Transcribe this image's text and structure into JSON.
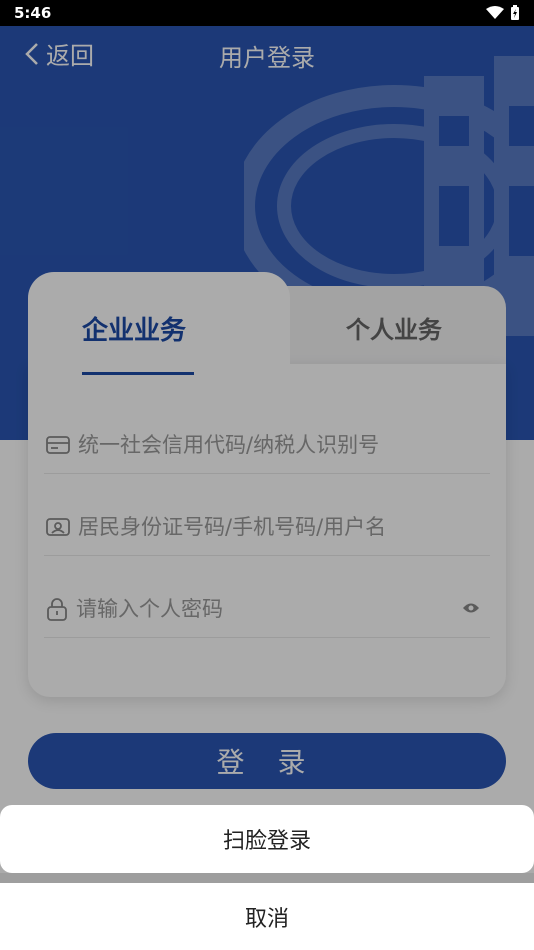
{
  "status_bar": {
    "time": "5:46"
  },
  "header": {
    "back_label": "返回",
    "title": "用户登录"
  },
  "tabs": [
    {
      "label": "企业业务",
      "active": true
    },
    {
      "label": "个人业务",
      "active": false
    }
  ],
  "form": {
    "credit_code_placeholder": "统一社会信用代码/纳税人识别号",
    "identity_placeholder": "居民身份证号码/手机号码/用户名",
    "password_placeholder": "请输入个人密码"
  },
  "login_button": "登 录",
  "action_sheet": {
    "face_login": "扫脸登录",
    "cancel": "取消"
  },
  "colors": {
    "brand": "#2a56b3",
    "tab_active": "#1c4aa6"
  }
}
